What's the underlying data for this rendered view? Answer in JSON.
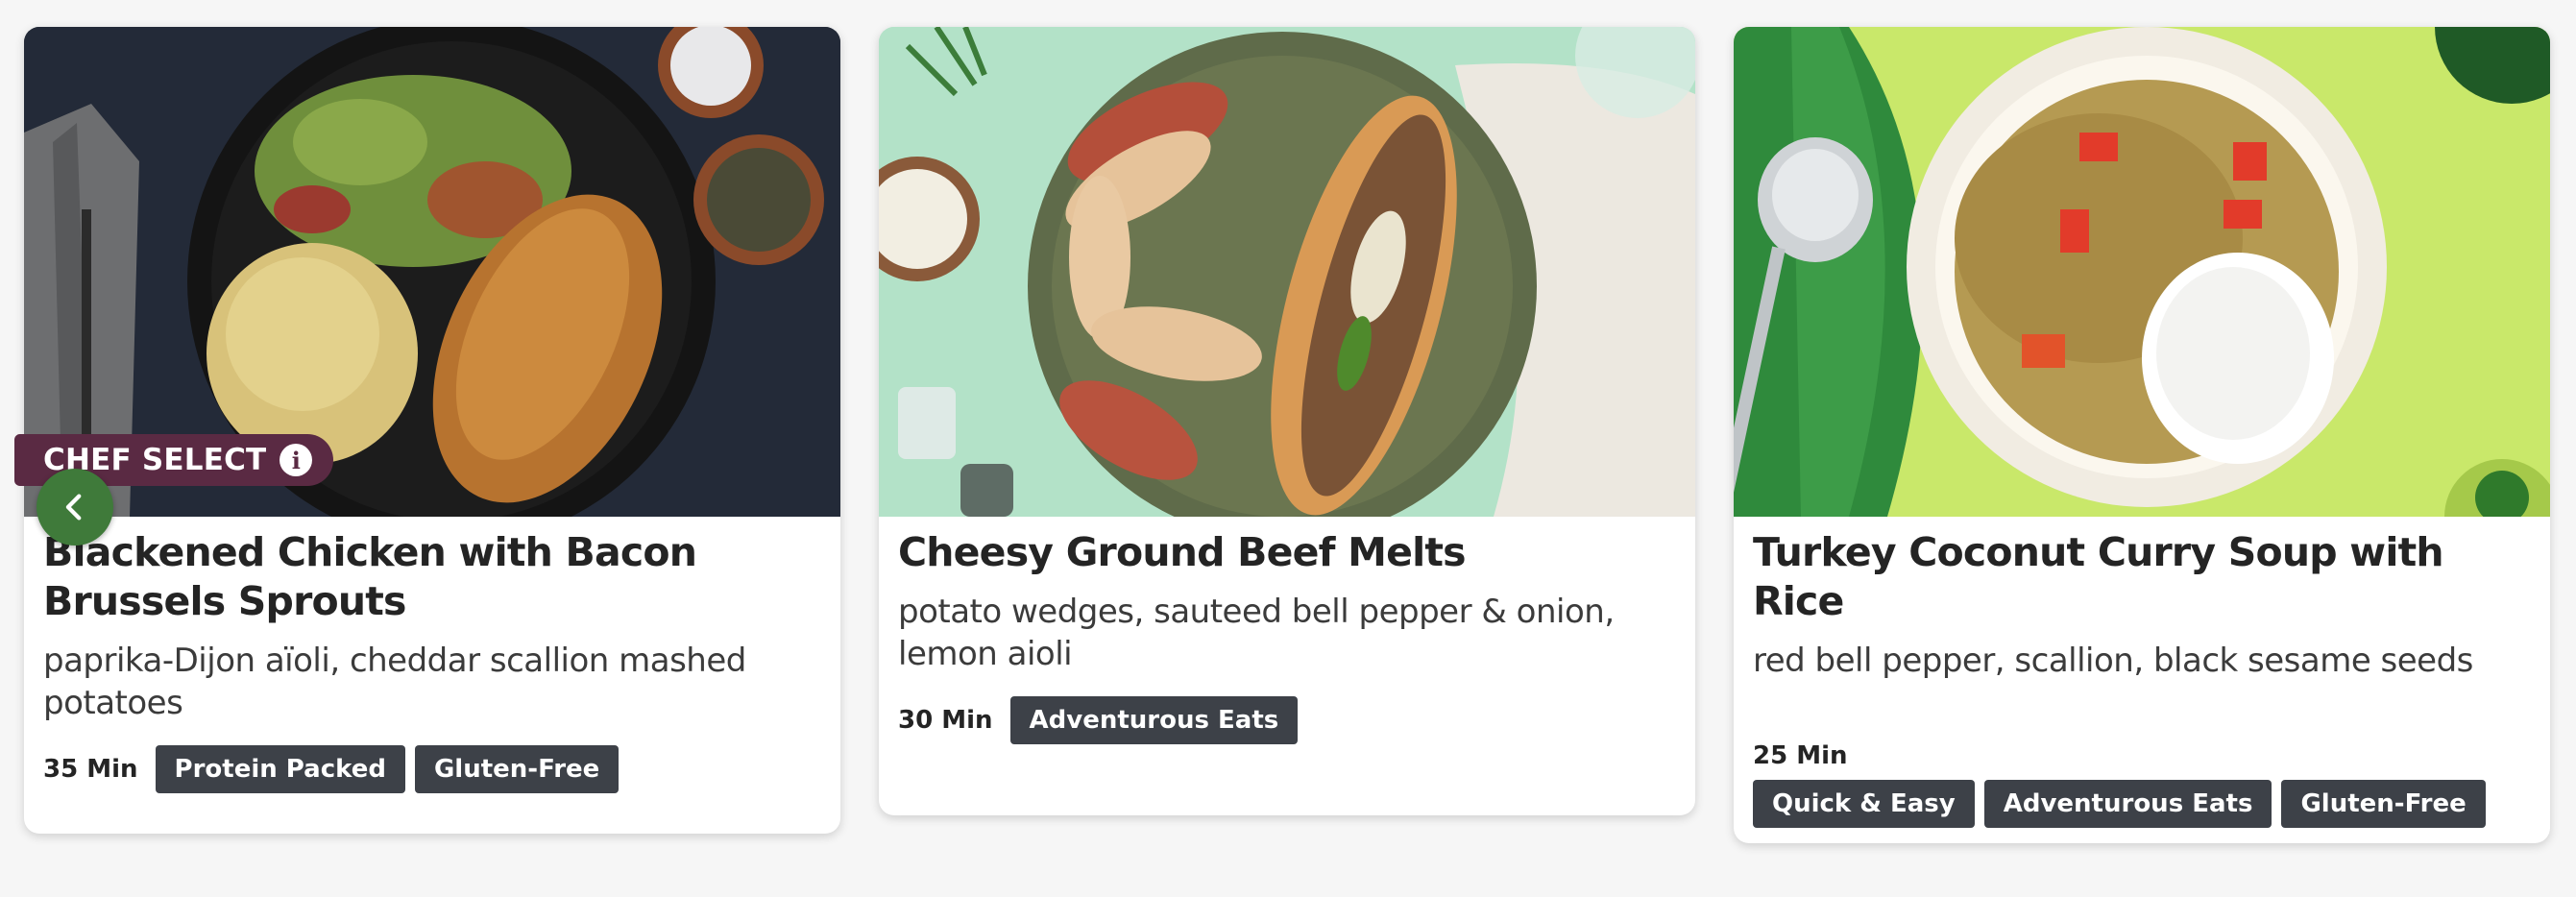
{
  "cards": [
    {
      "title": "Blackened Chicken with Bacon Brussels Sprouts",
      "description": "paprika-Dijon aïoli, cheddar scallion mashed potatoes",
      "time": "35 Min",
      "tags": [
        "Protein Packed",
        "Gluten-Free"
      ],
      "badge": "CHEF SELECT",
      "image_icon": "meal-photo-chicken"
    },
    {
      "title": "Cheesy Ground Beef Melts",
      "description": "potato wedges, sauteed bell pepper & onion, lemon aioli",
      "time": "30 Min",
      "tags": [
        "Adventurous Eats"
      ],
      "image_icon": "meal-photo-beef-melt"
    },
    {
      "title": "Turkey Coconut Curry Soup with Rice",
      "description": "red bell pepper, scallion, black sesame seeds",
      "time": "25 Min",
      "tags": [
        "Quick & Easy",
        "Adventurous Eats",
        "Gluten-Free"
      ],
      "image_icon": "meal-photo-curry"
    }
  ],
  "carousel": {
    "prev_icon": "chevron-left-icon"
  },
  "colors": {
    "tag_bg": "#3d4148",
    "badge_bg": "#5a2a43",
    "nav_button": "#3f7a3a",
    "page_bg": "#f6f6f6"
  }
}
